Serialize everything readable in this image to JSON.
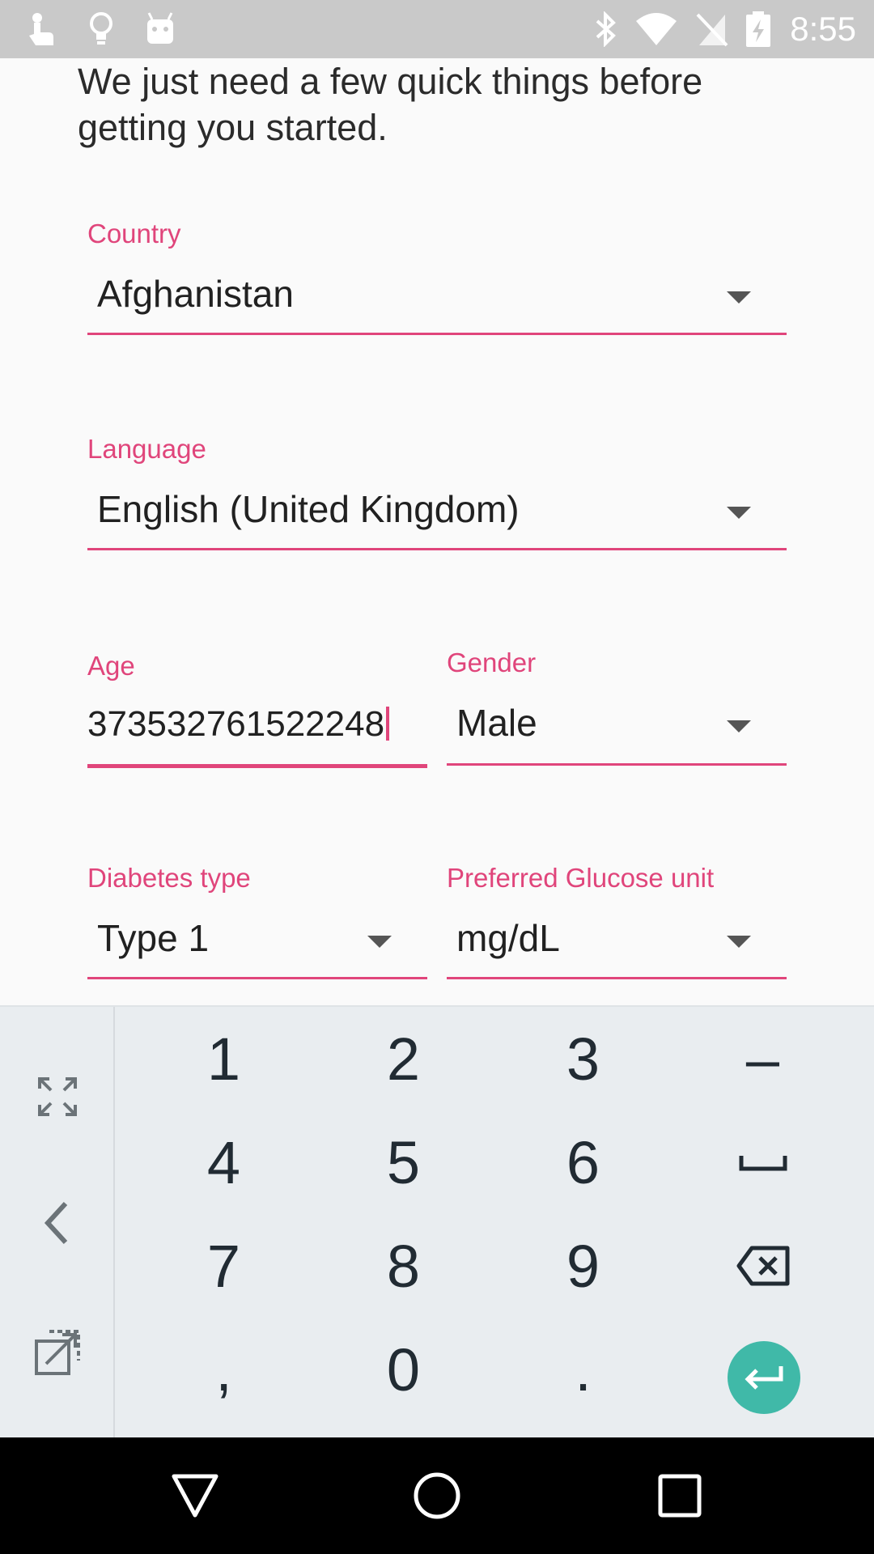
{
  "status_bar": {
    "time": "8:55",
    "left_icons": [
      "touch-app-icon",
      "lightbulb-icon",
      "android-icon"
    ],
    "right_icons": [
      "bluetooth-icon",
      "wifi-icon",
      "no-sim-icon",
      "battery-charging-icon"
    ]
  },
  "intro_text": "We just need a few quick things before getting you started.",
  "form": {
    "country": {
      "label": "Country",
      "value": "Afghanistan"
    },
    "language": {
      "label": "Language",
      "value": "English (United Kingdom)"
    },
    "age": {
      "label": "Age",
      "value": "373532761522248"
    },
    "gender": {
      "label": "Gender",
      "value": "Male"
    },
    "diabetes_type": {
      "label": "Diabetes type",
      "value": "Type 1"
    },
    "glucose_unit": {
      "label": "Preferred Glucose unit",
      "value": "mg/dL"
    }
  },
  "keyboard": {
    "keys": [
      "1",
      "2",
      "3",
      "–",
      "4",
      "5",
      "6",
      "␣",
      "7",
      "8",
      "9",
      "⌫",
      ",",
      "0",
      ".",
      "↵"
    ],
    "side_icons": [
      "fullscreen-icon",
      "chevron-left-icon",
      "open-external-icon"
    ]
  },
  "colors": {
    "accent": "#e0457b",
    "enter_key": "#40b9a8",
    "status_bar": "#c9c9c9",
    "keyboard_bg": "#e9edf0"
  }
}
